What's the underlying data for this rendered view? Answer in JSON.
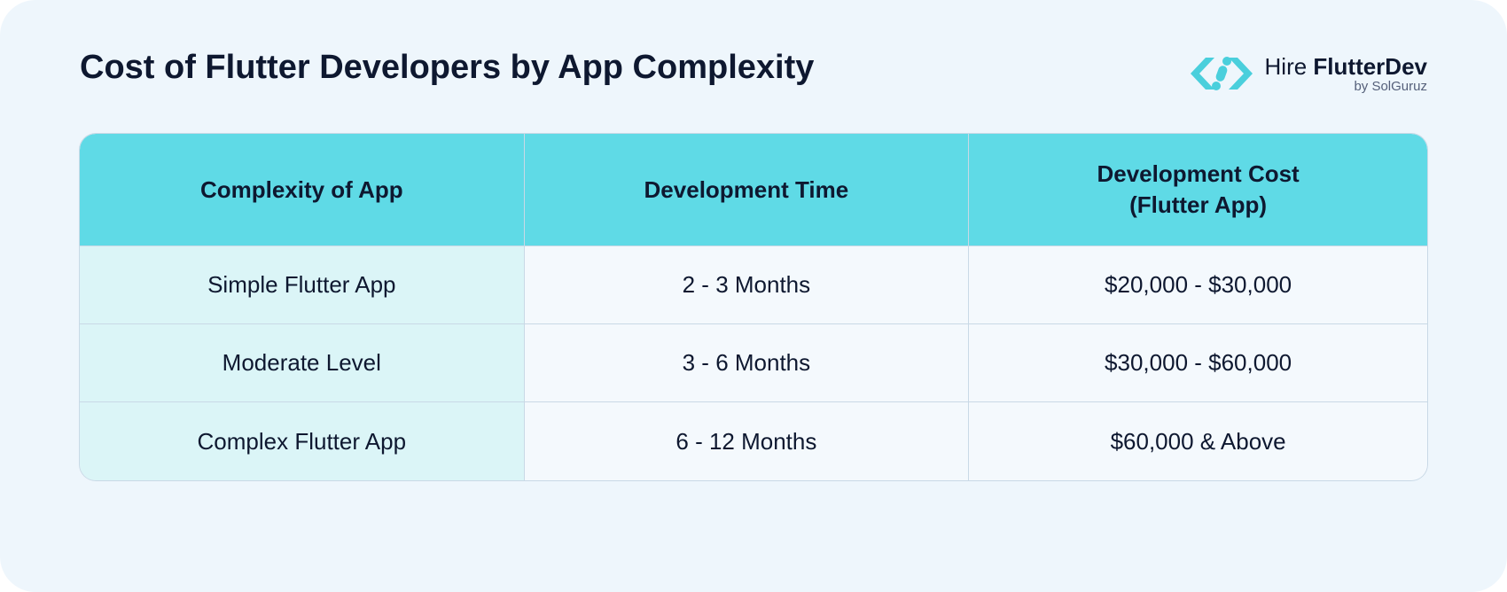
{
  "title": "Cost of Flutter Developers by App Complexity",
  "logo": {
    "brand_prefix": "Hire",
    "brand_suffix": "FlutterDev",
    "byline": "by SolGuruz"
  },
  "chart_data": {
    "type": "table",
    "title": "Cost of Flutter Developers by App Complexity",
    "headers": [
      "Complexity of App",
      "Development Time",
      "Development Cost\n(Flutter App)"
    ],
    "rows": [
      {
        "complexity": "Simple Flutter App",
        "time": "2 - 3 Months",
        "cost": "$20,000 - $30,000"
      },
      {
        "complexity": "Moderate Level",
        "time": "3 - 6 Months",
        "cost": "$30,000 - $60,000"
      },
      {
        "complexity": "Complex Flutter App",
        "time": "6 - 12 Months",
        "cost": "$60,000 & Above"
      }
    ]
  },
  "table": {
    "header_col1": "Complexity of App",
    "header_col2": "Development Time",
    "header_col3_line1": "Development Cost",
    "header_col3_line2": "(Flutter App)",
    "rows": [
      {
        "complexity": "Simple Flutter App",
        "time": "2 - 3 Months",
        "cost": "$20,000 - $30,000"
      },
      {
        "complexity": "Moderate Level",
        "time": "3 - 6 Months",
        "cost": "$30,000 - $60,000"
      },
      {
        "complexity": "Complex Flutter App",
        "time": "6 - 12 Months",
        "cost": "$60,000 & Above"
      }
    ]
  }
}
